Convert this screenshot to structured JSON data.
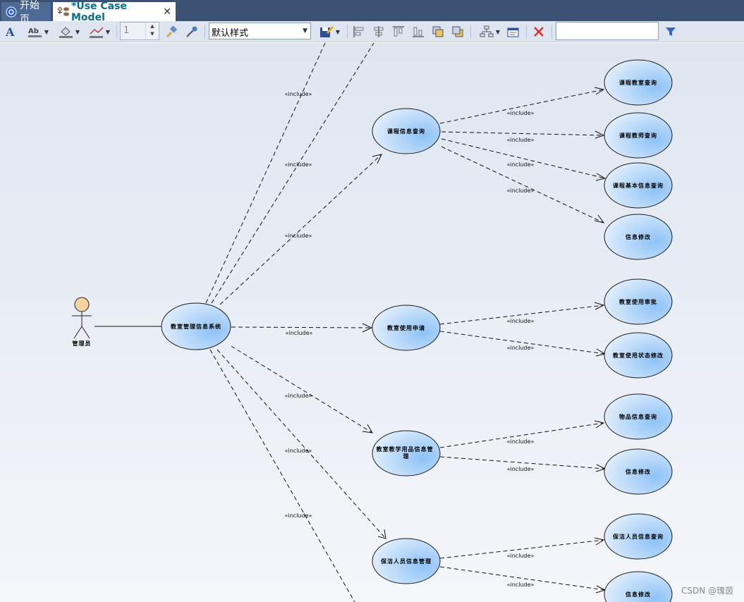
{
  "tabs": [
    {
      "label": "开始页",
      "icon": "start-page-icon"
    },
    {
      "label": "*Use Case Model",
      "icon": "use-case-model-icon",
      "close": "✕"
    }
  ],
  "toolbar": {
    "zoom_value": "1",
    "style_select": "默认样式",
    "find_value": "",
    "icons": [
      "font-icon",
      "text-color-icon",
      "fill-color-icon",
      "line-color-icon",
      "format-painter-icon",
      "eyedropper-icon",
      "save-style-icon",
      "align-left-icon",
      "align-center-icon",
      "align-top-icon",
      "align-bottom-icon",
      "bring-front-icon",
      "send-back-icon",
      "layout-icon",
      "properties-icon",
      "delete-icon",
      "filter-icon"
    ],
    "colors": {
      "delete": "#e03030",
      "filter": "#3a64c8"
    }
  },
  "diagram": {
    "colors": {
      "usecase_fill": "#8dc4f8",
      "usecase_stroke": "#1a1a1a",
      "actor_head": "#f6d4a0"
    },
    "actor": {
      "label": "管理员"
    },
    "root": {
      "label": "教室管理信息系统"
    },
    "include_label": "«include»",
    "mid": [
      {
        "id": "m1",
        "label": "课程信息查询"
      },
      {
        "id": "m2",
        "label": "教室使用申请"
      },
      {
        "id": "m3",
        "label": "教室教学用品信息管理"
      },
      {
        "id": "m4",
        "label": "保洁人员信息管理"
      }
    ],
    "leaves": [
      {
        "label": "课程教室查询"
      },
      {
        "label": "课程教师查询"
      },
      {
        "label": "课程基本信息查询"
      },
      {
        "label": "信息修改"
      },
      {
        "label": "教室使用审批"
      },
      {
        "label": "教室使用状态修改"
      },
      {
        "label": "物品信息查询"
      },
      {
        "label": "信息修改"
      },
      {
        "label": "保洁人员信息查询"
      },
      {
        "label": "信息修改"
      }
    ]
  },
  "watermark": "CSDN @瑰茵"
}
